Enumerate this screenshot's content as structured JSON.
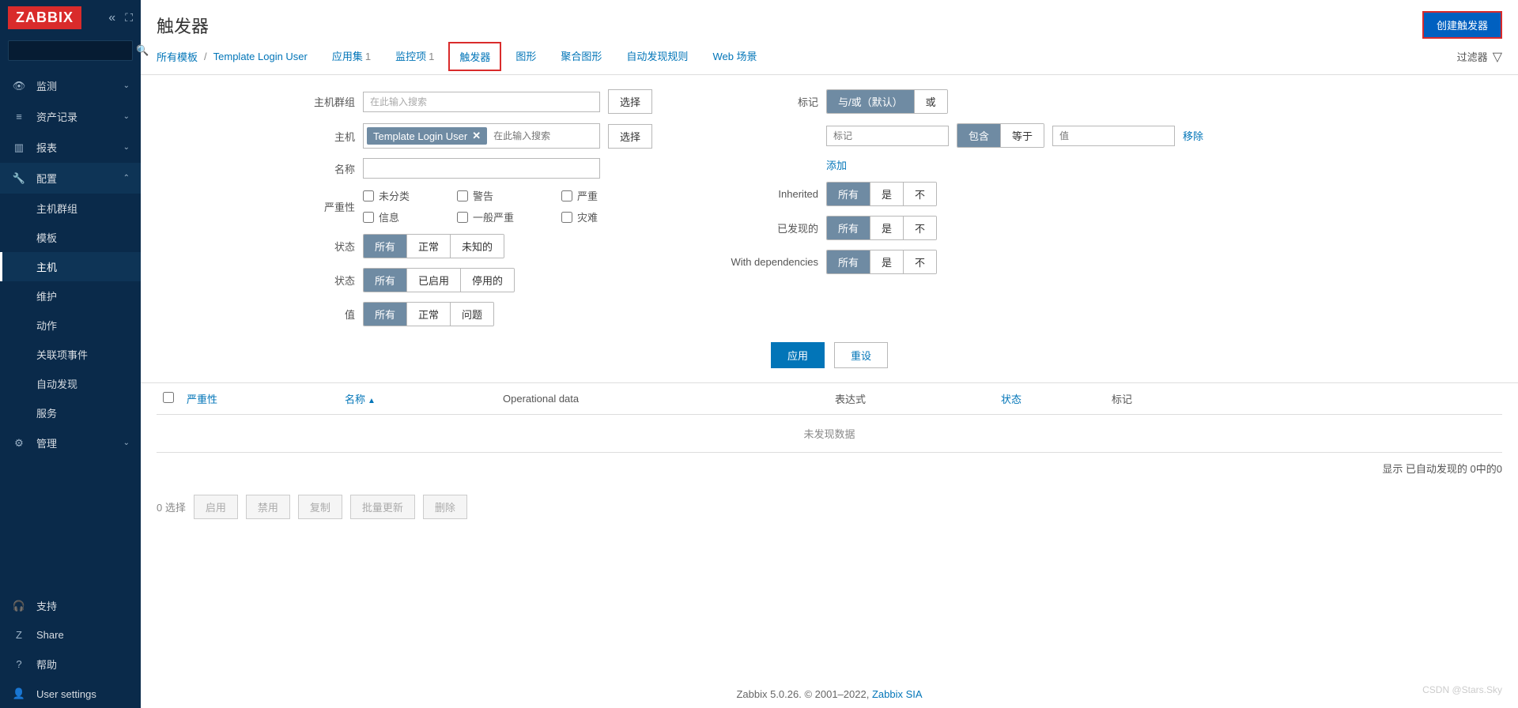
{
  "brand": "ZABBIX",
  "sidebar": {
    "search_placeholder": "",
    "items": [
      {
        "icon": "👁",
        "label": "监测",
        "exp": true
      },
      {
        "icon": "≡",
        "label": "资产记录",
        "exp": true
      },
      {
        "icon": "▥",
        "label": "报表",
        "exp": true
      },
      {
        "icon": "🔧",
        "label": "配置",
        "exp": true,
        "open": true
      },
      {
        "icon": "⚙",
        "label": "管理",
        "exp": true
      }
    ],
    "config_sub": [
      {
        "label": "主机群组"
      },
      {
        "label": "模板"
      },
      {
        "label": "主机",
        "sel": true
      },
      {
        "label": "维护"
      },
      {
        "label": "动作"
      },
      {
        "label": "关联项事件"
      },
      {
        "label": "自动发现"
      },
      {
        "label": "服务"
      }
    ],
    "bottom": [
      {
        "icon": "🎧",
        "label": "支持"
      },
      {
        "icon": "Z",
        "label": "Share"
      },
      {
        "icon": "?",
        "label": "帮助"
      },
      {
        "icon": "👤",
        "label": "User settings"
      }
    ]
  },
  "page": {
    "title": "触发器",
    "create_btn": "创建触发器",
    "breadcrumb": {
      "all": "所有模板",
      "template": "Template Login User"
    },
    "tabs": [
      {
        "label": "应用集",
        "count": "1"
      },
      {
        "label": "监控项",
        "count": "1"
      },
      {
        "label": "触发器",
        "active": true
      },
      {
        "label": "图形"
      },
      {
        "label": "聚合图形"
      },
      {
        "label": "自动发现规则"
      },
      {
        "label": "Web 场景"
      }
    ],
    "filter_label": "过滤器"
  },
  "filter": {
    "labels": {
      "hostgroup": "主机群组",
      "host": "主机",
      "name": "名称",
      "severity": "严重性",
      "state": "状态",
      "status": "状态",
      "value": "值",
      "tags": "标记",
      "inherited": "Inherited",
      "discovered": "已发现的",
      "deps": "With dependencies"
    },
    "placeholders": {
      "search": "在此输入搜索",
      "tag": "标记",
      "value": "值"
    },
    "host_chip": "Template Login User",
    "select_btn": "选择",
    "severity": {
      "unclassified": "未分类",
      "warning": "警告",
      "high": "严重",
      "info": "信息",
      "average": "一般严重",
      "disaster": "灾难"
    },
    "state": {
      "all": "所有",
      "normal": "正常",
      "unknown": "未知的"
    },
    "status": {
      "all": "所有",
      "enabled": "已启用",
      "disabled": "停用的"
    },
    "value": {
      "all": "所有",
      "ok": "正常",
      "problem": "问题"
    },
    "tag_mode": {
      "andor": "与/或（默认）",
      "or": "或"
    },
    "tag_op": {
      "contains": "包含",
      "equals": "等于"
    },
    "tag_remove": "移除",
    "tag_add": "添加",
    "triple": {
      "all": "所有",
      "yes": "是",
      "no": "不"
    },
    "apply": "应用",
    "reset": "重设"
  },
  "table": {
    "cols": {
      "severity": "严重性",
      "name": "名称",
      "opdata": "Operational data",
      "expression": "表达式",
      "status": "状态",
      "tags": "标记"
    },
    "no_data": "未发现数据",
    "footer": "显示 已自动发现的 0中的0"
  },
  "bulk": {
    "count": "0 选择",
    "enable": "启用",
    "disable": "禁用",
    "copy": "复制",
    "massupdate": "批量更新",
    "delete": "删除"
  },
  "footer": {
    "text": "Zabbix 5.0.26. © 2001–2022, ",
    "link": "Zabbix SIA"
  },
  "watermark": "CSDN @Stars.Sky"
}
